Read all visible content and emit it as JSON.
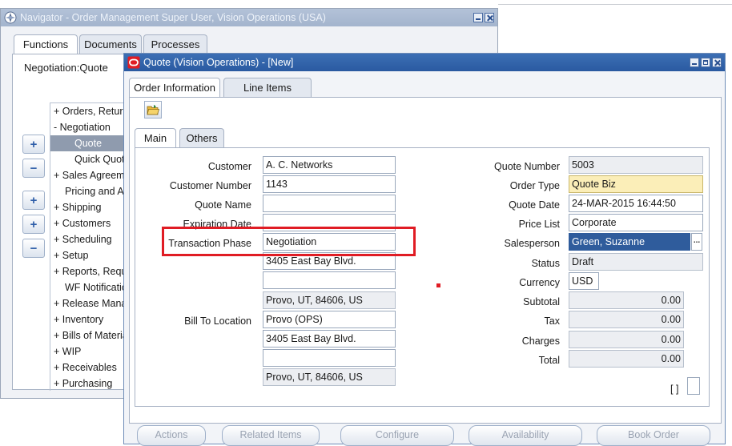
{
  "navigator": {
    "title": "Navigator - Order Management Super User, Vision Operations (USA)",
    "tabs": [
      "Functions",
      "Documents",
      "Processes"
    ],
    "context": "Negotiation:Quote",
    "side_buttons": [
      "+",
      "−",
      "+",
      "+",
      "−"
    ],
    "tree": [
      "+ Orders, Returns",
      "- Negotiation",
      "Quote",
      "Quick Quote",
      "+ Sales Agreements",
      "Pricing and Availability",
      "+ Shipping",
      "+ Customers",
      "+ Scheduling",
      "+ Setup",
      "+ Reports, Requests",
      "WF Notifications",
      "+ Release Management",
      "+ Inventory",
      "+ Bills of Material",
      "+ WIP",
      "+ Receivables",
      "+ Purchasing"
    ]
  },
  "quote": {
    "title": "Quote (Vision Operations) - [New]",
    "tabs": [
      "Order Information",
      "Line Items"
    ],
    "subtabs": [
      "Main",
      "Others"
    ],
    "left": {
      "customer": {
        "label": "Customer",
        "value": "A. C. Networks"
      },
      "customer_number": {
        "label": "Customer Number",
        "value": "1143"
      },
      "quote_name": {
        "label": "Quote Name",
        "value": ""
      },
      "expiration_date": {
        "label": "Expiration Date",
        "value": ""
      },
      "transaction_phase": {
        "label": "Transaction Phase",
        "value": "Negotiation"
      },
      "ship_to_line1": "3405 East Bay Blvd.",
      "ship_to_line2": "",
      "ship_to_line3": "Provo, UT, 84606, US",
      "bill_to": {
        "label": "Bill To Location",
        "value": "Provo (OPS)"
      },
      "bill_to_line1": "3405 East Bay Blvd.",
      "bill_to_line2": "",
      "bill_to_line3": "Provo, UT, 84606, US"
    },
    "right": {
      "quote_number": {
        "label": "Quote Number",
        "value": "5003"
      },
      "order_type": {
        "label": "Order Type",
        "value": "Quote Biz"
      },
      "quote_date": {
        "label": "Quote Date",
        "value": "24-MAR-2015 16:44:50"
      },
      "price_list": {
        "label": "Price List",
        "value": "Corporate"
      },
      "salesperson": {
        "label": "Salesperson",
        "value": "Green, Suzanne"
      },
      "status": {
        "label": "Status",
        "value": "Draft"
      },
      "currency": {
        "label": "Currency",
        "value": "USD"
      },
      "subtotal": {
        "label": "Subtotal",
        "value": "0.00"
      },
      "tax": {
        "label": "Tax",
        "value": "0.00"
      },
      "charges": {
        "label": "Charges",
        "value": "0.00"
      },
      "total": {
        "label": "Total",
        "value": "0.00"
      }
    },
    "bracket": "[ ]",
    "lov_symbol": "...",
    "bottom_buttons": [
      "Actions",
      "Related Items",
      "Configure",
      "Availability",
      "Book Order"
    ]
  },
  "colors": {
    "highlight": "#e01c24",
    "titlebar": "#2a5aa1",
    "required": "#fbeeb8",
    "selected": "#2f5c9c"
  }
}
